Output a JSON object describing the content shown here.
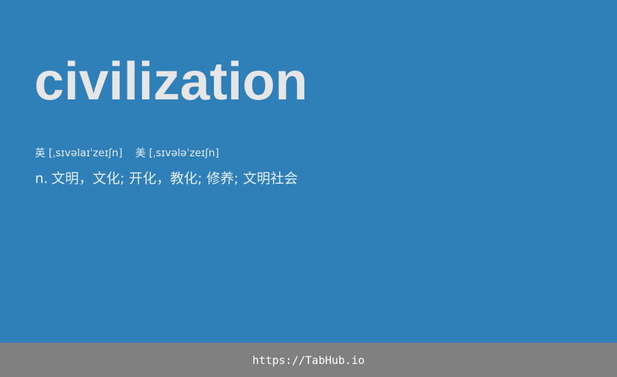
{
  "word": "civilization",
  "phonetics": {
    "uk_label": "英",
    "uk_ipa": "[ˌsɪvəlaɪˈzeɪʃn]",
    "us_label": "美",
    "us_ipa": "[ˌsɪvələˈzeɪʃn]"
  },
  "definition": {
    "pos": "n.",
    "meaning": "文明，文化; 开化，教化; 修养; 文明社会"
  },
  "footer": {
    "url": "https://TabHub.io"
  },
  "colors": {
    "background": "#2f80b8",
    "footer_background": "#808080",
    "word_text": "#e6e6e6"
  }
}
